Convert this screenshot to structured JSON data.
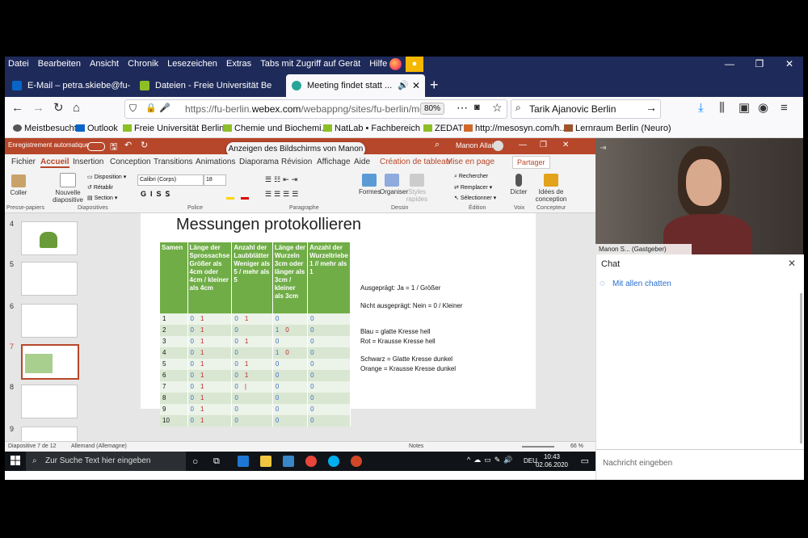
{
  "browser": {
    "menu": [
      "Datei",
      "Bearbeiten",
      "Ansicht",
      "Chronik",
      "Lesezeichen",
      "Extras",
      "Tabs mit Zugriff auf Gerät",
      "Hilfe"
    ],
    "tabs": [
      {
        "label": "E-Mail – petra.skiebe@fu-berlin",
        "active": false,
        "color": "#0a64c8"
      },
      {
        "label": "Dateien - Freie Universität Berlin",
        "active": false,
        "color": "#8cbf26"
      },
      {
        "label": "Meeting findet statt ...",
        "active": true,
        "color": "#26a69a"
      }
    ],
    "url_prefix": "https://fu-berlin.",
    "url_domain": "webex.com",
    "url_rest": "/webappng/sites/fu-berlin/mee",
    "zoom": "80%",
    "search_value": "Tarik Ajanovic Berlin",
    "bookmarks": [
      {
        "label": "Meistbesucht",
        "color": "#555"
      },
      {
        "label": "Outlook",
        "color": "#0a64c8"
      },
      {
        "label": "Freie Universität Berlin...",
        "color": "#8cbf26"
      },
      {
        "label": "Chemie und Biochemi...",
        "color": "#8cbf26"
      },
      {
        "label": "NatLab • Fachbereich ...",
        "color": "#8cbf26"
      },
      {
        "label": "ZEDAT",
        "color": "#8cbf26"
      },
      {
        "label": "http://mesosyn.com/h...",
        "color": "#d06a2c"
      },
      {
        "label": "Lernraum Berlin (Neuro)",
        "color": "#a0522d"
      }
    ]
  },
  "ppt": {
    "autosave": "Enregistrement automatique",
    "share_banner": "Anzeigen des Bildschirms von Manon ...",
    "user": "Manon Allain",
    "ribbon_tabs": [
      "Fichier",
      "Accueil",
      "Insertion",
      "Conception",
      "Transitions",
      "Animations",
      "Diaporama",
      "Révision",
      "Affichage",
      "Aide",
      "Création de tableau",
      "Mise en page"
    ],
    "share_btn": "Partager",
    "groups": [
      "Presse-papiers",
      "Diapositives",
      "Police",
      "Paragraphe",
      "Dessin",
      "Édition",
      "Voix",
      "Concepteur"
    ],
    "buttons": {
      "paste": "Coller",
      "new_slide": "Nouvelle diapositive",
      "layout": "Disposition",
      "reset": "Rétablir",
      "section": "Section",
      "font": "Calibri (Corps)",
      "size": "18",
      "shapes": "Formes",
      "arrange": "Organiser",
      "styles": "Styles rapides",
      "find": "Rechercher",
      "replace": "Remplacer",
      "select": "Sélectionner",
      "dictate": "Dicter",
      "ideas": "Idées de conception"
    },
    "thumb_numbers": [
      "4",
      "5",
      "6",
      "7",
      "8",
      "9"
    ],
    "slide_title": "Messungen protokollieren",
    "table_headers": [
      "Samen",
      "Länge der Sprossachse Größer als 4cm oder 4cm / kleiner als 4cm",
      "Anzahl der Laubblätter Weniger als 5 / mehr als 5",
      "Länge der Wurzeln 3cm oder länger als 3cm / kleiner als 3cm",
      "Anzahl der Wurzeltriebe 1 // mehr als 1"
    ],
    "table_rows": [
      [
        "1",
        "0",
        "1",
        "0",
        "1",
        "0",
        "",
        "0"
      ],
      [
        "2",
        "0",
        "1",
        "0",
        "",
        "1",
        "0",
        "0"
      ],
      [
        "3",
        "0",
        "1",
        "0",
        "1",
        "0",
        "",
        "0"
      ],
      [
        "4",
        "0",
        "1",
        "0",
        "",
        "1",
        "0",
        "0"
      ],
      [
        "5",
        "0",
        "1",
        "0",
        "1",
        "0",
        "",
        "0"
      ],
      [
        "6",
        "0",
        "1",
        "0",
        "1",
        "0",
        "",
        "0"
      ],
      [
        "7",
        "0",
        "1",
        "0",
        "|",
        "0",
        "",
        "0"
      ],
      [
        "8",
        "0",
        "1",
        "0",
        "",
        "0",
        "",
        "0"
      ],
      [
        "9",
        "0",
        "1",
        "0",
        "",
        "0",
        "",
        "0"
      ],
      [
        "10",
        "0",
        "1",
        "0",
        "",
        "0",
        "",
        "0"
      ]
    ],
    "legend": [
      "Ausgeprägt: Ja = 1 / Größer",
      "Nicht ausgeprägt: Nein = 0 / Kleiner",
      "Blau = glatte Kresse hell",
      "Rot = Krausse Kresse hell",
      "Schwarz = Glatte Kresse dunkel",
      "Orange = Krausse Kresse dunkel"
    ],
    "status_slide": "Diapositive 7 de 12",
    "status_lang": "Allemand (Allemagne)",
    "status_notes": "Notes",
    "status_zoom": "66 %"
  },
  "taskbar": {
    "search_placeholder": "Zur Suche Text hier eingeben",
    "lang": "DEU",
    "time": "10:43",
    "date": "02.06.2020"
  },
  "webex": {
    "host_name": "Manon S...",
    "host_role": "(Gastgeber)",
    "chat_title": "Chat",
    "chat_all": "Mit allen chatten",
    "chat_placeholder": "Nachricht eingeben"
  }
}
